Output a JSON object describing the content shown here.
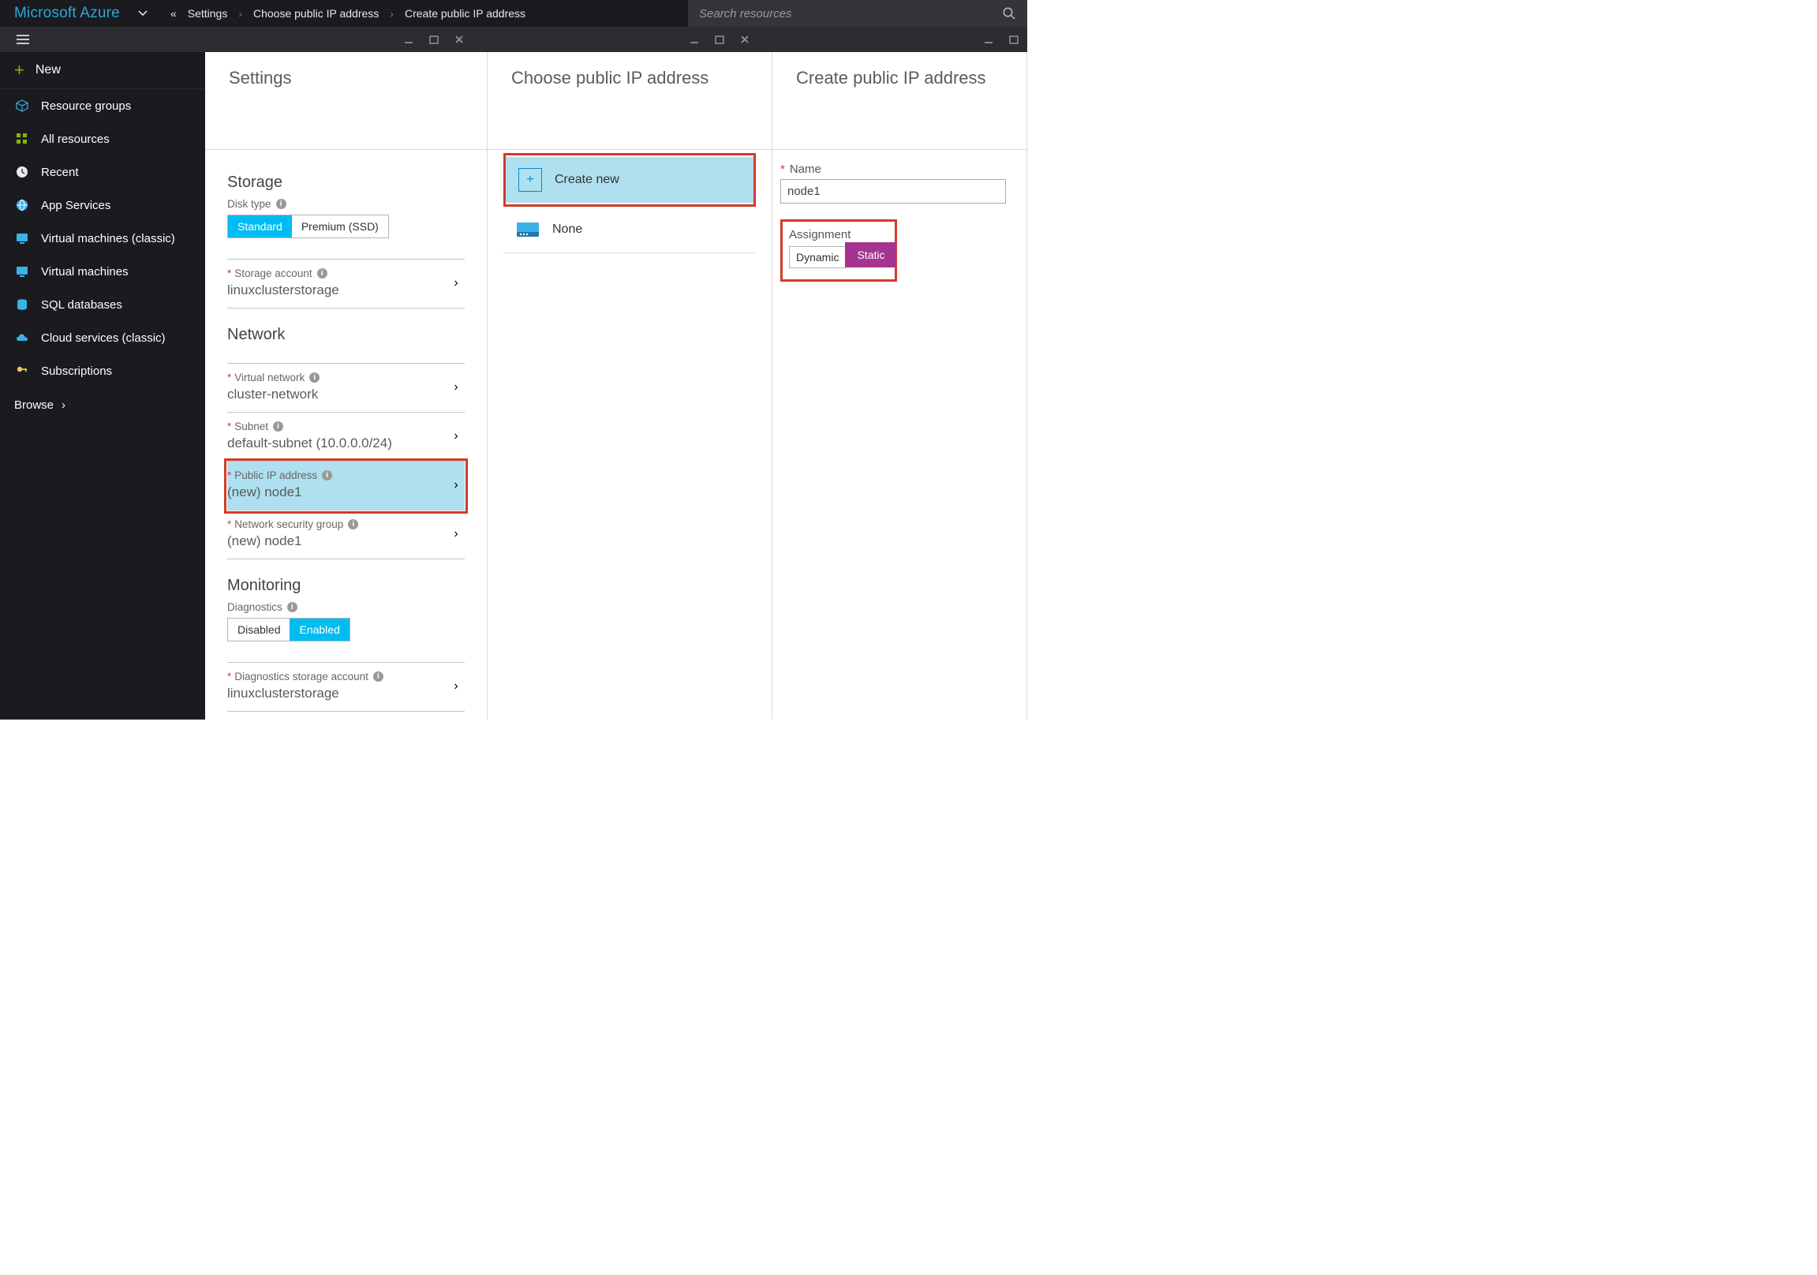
{
  "brand": "Microsoft Azure",
  "breadcrumbs": {
    "back": "«",
    "items": [
      "Settings",
      "Choose public IP address",
      "Create public IP address"
    ]
  },
  "search_placeholder": "Search resources",
  "leftnav": {
    "new_label": "New",
    "items": [
      {
        "label": "Resource groups"
      },
      {
        "label": "All resources"
      },
      {
        "label": "Recent"
      },
      {
        "label": "App Services"
      },
      {
        "label": "Virtual machines (classic)"
      },
      {
        "label": "Virtual machines"
      },
      {
        "label": "SQL databases"
      },
      {
        "label": "Cloud services (classic)"
      },
      {
        "label": "Subscriptions"
      }
    ],
    "browse": "Browse"
  },
  "blades": {
    "settings": {
      "title": "Settings",
      "storage_h": "Storage",
      "disk_type_label": "Disk type",
      "disk_type": {
        "options": [
          "Standard",
          "Premium (SSD)"
        ],
        "active": "Standard"
      },
      "rows": [
        {
          "label": "Storage account",
          "value": "linuxclusterstorage"
        }
      ],
      "network_h": "Network",
      "netrows": [
        {
          "label": "Virtual network",
          "value": "cluster-network"
        },
        {
          "label": "Subnet",
          "value": "default-subnet (10.0.0.0/24)"
        },
        {
          "label": "Public IP address",
          "value": "(new) node1",
          "selected": true
        },
        {
          "label": "Network security group",
          "value": "(new) node1"
        }
      ],
      "monitoring_h": "Monitoring",
      "diag_label": "Diagnostics",
      "diag": {
        "options": [
          "Disabled",
          "Enabled"
        ],
        "active": "Enabled"
      },
      "diagrows": [
        {
          "label": "Diagnostics storage account",
          "value": "linuxclusterstorage"
        }
      ]
    },
    "choose": {
      "title": "Choose public IP address",
      "create_new": "Create new",
      "none": "None"
    },
    "create": {
      "title": "Create public IP address",
      "name_label": "Name",
      "name_value": "node1",
      "assignment_label": "Assignment",
      "assignment": {
        "options": [
          "Dynamic",
          "Static"
        ],
        "active": "Static"
      }
    }
  }
}
